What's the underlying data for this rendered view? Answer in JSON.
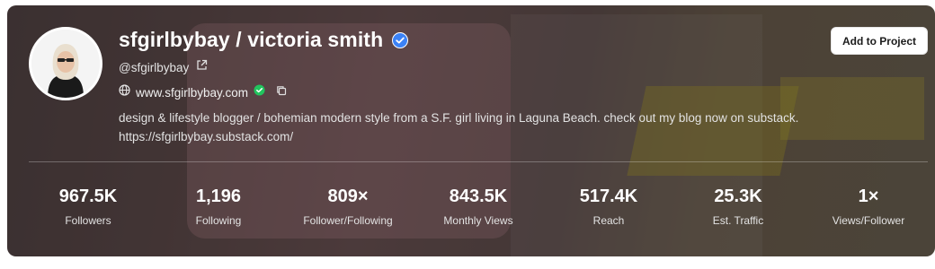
{
  "profile": {
    "title": "sfgirlbybay / victoria smith",
    "handle": "@sfgirlbybay",
    "website": "www.sfgirlbybay.com",
    "bio": "design & lifestyle blogger / bohemian modern style from a S.F. girl living in Laguna Beach. check out my blog now on substack. https://sfgirlbybay.substack.com/"
  },
  "actions": {
    "add_to_project": "Add to Project"
  },
  "stats": [
    {
      "value": "967.5K",
      "label": "Followers"
    },
    {
      "value": "1,196",
      "label": "Following"
    },
    {
      "value": "809×",
      "label": "Follower/Following"
    },
    {
      "value": "843.5K",
      "label": "Monthly Views"
    },
    {
      "value": "517.4K",
      "label": "Reach"
    },
    {
      "value": "25.3K",
      "label": "Est. Traffic"
    },
    {
      "value": "1×",
      "label": "Views/Follower"
    }
  ],
  "icons": {
    "verified": "verified-badge-icon",
    "external_link": "external-link-icon",
    "globe": "globe-icon",
    "site_verified": "check-circle-icon",
    "copy": "copy-icon"
  },
  "colors": {
    "verified_blue": "#3b82f6",
    "site_verified_green": "#22c55e"
  }
}
